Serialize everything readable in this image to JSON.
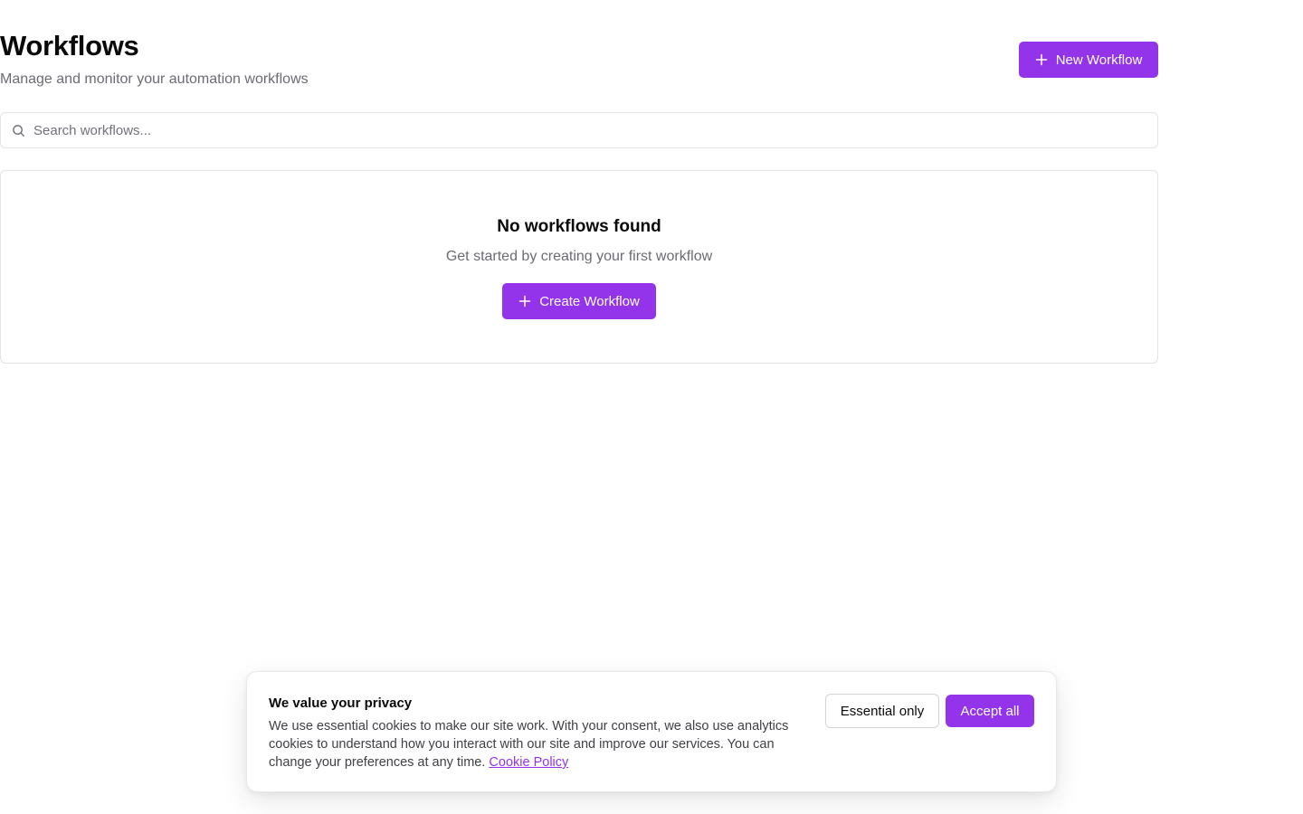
{
  "header": {
    "title": "Workflows",
    "subtitle": "Manage and monitor your automation workflows",
    "new_button_label": "New Workflow"
  },
  "search": {
    "placeholder": "Search workflows...",
    "value": ""
  },
  "empty_state": {
    "title": "No workflows found",
    "subtitle": "Get started by creating your first workflow",
    "create_button_label": "Create Workflow"
  },
  "cookie_banner": {
    "title": "We value your privacy",
    "text": "We use essential cookies to make our site work. With your consent, we also use analytics cookies to understand how you interact with our site and improve our services. You can change your preferences at any time.",
    "link_label": "Cookie Policy",
    "essential_button_label": "Essential only",
    "accept_button_label": "Accept all"
  },
  "icons": {
    "new_workflow": "plus-icon",
    "create_workflow": "plus-icon",
    "search": "search-icon"
  },
  "colors": {
    "accent": "#9333ea",
    "text_primary": "#0a0a0a",
    "text_muted": "#6b6b73",
    "border": "#e4e4e7"
  }
}
